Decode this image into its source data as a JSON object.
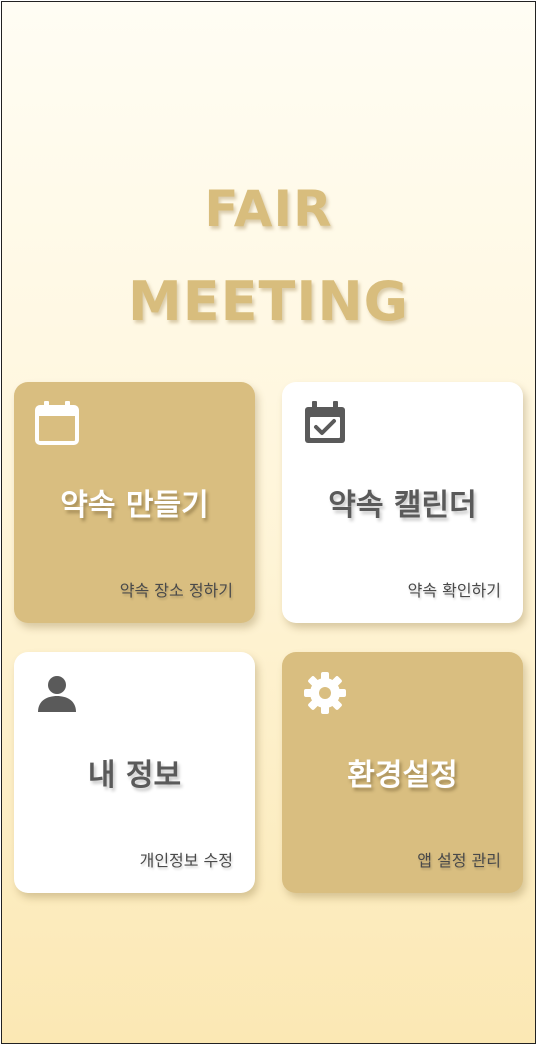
{
  "header": {
    "title_line1": "FAIR",
    "title_line2": "MEETING"
  },
  "colors": {
    "accent_gold": "#d9be80",
    "tile_white": "#ffffff",
    "title_gold": "#d8bd7d",
    "text_dark": "#5a5a5a"
  },
  "menu": {
    "tiles": [
      {
        "icon": "calendar-icon",
        "label": "약속 만들기",
        "sublabel": "약속 장소 정하기",
        "style": "gold"
      },
      {
        "icon": "calendar-check-icon",
        "label": "약속 캘린더",
        "sublabel": "약속 확인하기",
        "style": "white"
      },
      {
        "icon": "person-icon",
        "label": "내 정보",
        "sublabel": "개인정보 수정",
        "style": "white"
      },
      {
        "icon": "gear-icon",
        "label": "환경설정",
        "sublabel": "앱 설정 관리",
        "style": "gold"
      }
    ]
  }
}
